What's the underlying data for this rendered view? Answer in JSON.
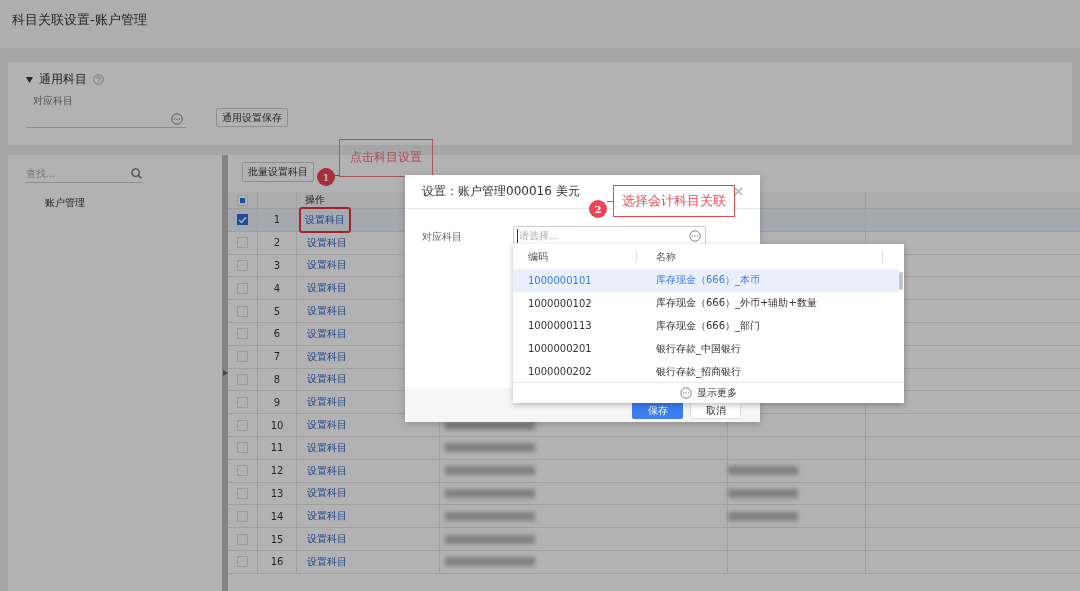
{
  "page": {
    "title": "科目关联设置-账户管理"
  },
  "general": {
    "title": "通用科目",
    "expanded": true,
    "field_label": "对应科目",
    "save_button": "通用设置保存"
  },
  "sidebar": {
    "search_placeholder": "查找...",
    "items": [
      {
        "label": "账户管理",
        "selected": false
      }
    ]
  },
  "toolbar": {
    "batch_button": "批量设置科目"
  },
  "table": {
    "select_all": {
      "indeterminate": true
    },
    "columns": [
      "操作"
    ],
    "rows": [
      {
        "index": "1",
        "action": "设置科目",
        "checked": true,
        "highlighted": true
      },
      {
        "index": "2",
        "action": "设置科目",
        "checked": false,
        "highlighted": false
      },
      {
        "index": "3",
        "action": "设置科目",
        "checked": false,
        "highlighted": false
      },
      {
        "index": "4",
        "action": "设置科目",
        "checked": false,
        "highlighted": false
      },
      {
        "index": "5",
        "action": "设置科目",
        "checked": false,
        "highlighted": false
      },
      {
        "index": "6",
        "action": "设置科目",
        "checked": false,
        "highlighted": false
      },
      {
        "index": "7",
        "action": "设置科目",
        "checked": false,
        "highlighted": false
      },
      {
        "index": "8",
        "action": "设置科目",
        "checked": false,
        "highlighted": false
      },
      {
        "index": "9",
        "action": "设置科目",
        "checked": false,
        "highlighted": false
      },
      {
        "index": "10",
        "action": "设置科目",
        "checked": false,
        "highlighted": false,
        "redacted_4": true,
        "redacted_5": false
      },
      {
        "index": "11",
        "action": "设置科目",
        "checked": false,
        "highlighted": false,
        "redacted_4": true,
        "redacted_5": false
      },
      {
        "index": "12",
        "action": "设置科目",
        "checked": false,
        "highlighted": false,
        "redacted_4": true,
        "redacted_5": true
      },
      {
        "index": "13",
        "action": "设置科目",
        "checked": false,
        "highlighted": false,
        "redacted_4": true,
        "redacted_5": true
      },
      {
        "index": "14",
        "action": "设置科目",
        "checked": false,
        "highlighted": false,
        "redacted_4": true,
        "redacted_5": true
      },
      {
        "index": "15",
        "action": "设置科目",
        "checked": false,
        "highlighted": false,
        "redacted_4": true,
        "redacted_5": false
      },
      {
        "index": "16",
        "action": "设置科目",
        "checked": false,
        "highlighted": false,
        "redacted_4": true,
        "redacted_5": false
      }
    ]
  },
  "dialog": {
    "title": "设置：账户管理000016 美元",
    "field_label": "对应科目",
    "placeholder": "请选择...",
    "buttons": [
      {
        "label": "保存",
        "kind": "primary"
      },
      {
        "label": "取消",
        "kind": "default"
      }
    ],
    "dropdown": {
      "columns": [
        "编码",
        "名称"
      ],
      "rows": [
        {
          "code": "1000000101",
          "name": "库存现金（666）_本币",
          "selected": true
        },
        {
          "code": "1000000102",
          "name": "库存现金（666）_外币+辅助+数量",
          "selected": false
        },
        {
          "code": "1000000113",
          "name": "库存现金（666）_部门",
          "selected": false
        },
        {
          "code": "1000000201",
          "name": "银行存款_中国银行",
          "selected": false
        },
        {
          "code": "1000000202",
          "name": "银行存款_招商银行",
          "selected": false
        }
      ],
      "more": "显示更多"
    }
  },
  "annotations": [
    {
      "number": "1",
      "text": "点击科目设置",
      "dimmed": true
    },
    {
      "number": "2",
      "text": "选择会计科目关联",
      "dimmed": false
    }
  ]
}
